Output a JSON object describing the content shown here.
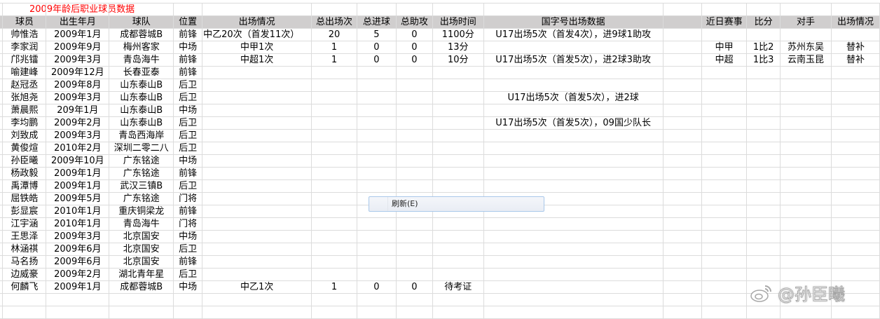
{
  "sheet_title": "2009年龄后职业球员数据",
  "headers": [
    "球员",
    "出生年月",
    "球队",
    "位置",
    "出场情况",
    "总出场次",
    "总进球",
    "总助攻",
    "出场时间",
    "国字号出场数据",
    "",
    "近日赛事",
    "比分",
    "对手",
    "出场情况"
  ],
  "players": [
    {
      "name": "帅惟浩",
      "birth": "2009年1月",
      "team": "成都蓉城B",
      "pos": "前锋",
      "apps": "中乙20次（首发11次）",
      "total": "20",
      "goals": "5",
      "assists": "0",
      "time": "1100分",
      "national": "U17出场5次（首发4次），进9球1助攻",
      "match": "",
      "score": "",
      "opponent": "",
      "status": ""
    },
    {
      "name": "李家润",
      "birth": "2009年9月",
      "team": "梅州客家",
      "pos": "中场",
      "apps": "中甲1次",
      "total": "1",
      "goals": "0",
      "assists": "0",
      "time": "13分",
      "national": "",
      "match": "中甲",
      "score": "1比2",
      "opponent": "苏州东吴",
      "status": "替补"
    },
    {
      "name": "邝兆镭",
      "birth": "2009年3月",
      "team": "青岛海牛",
      "pos": "前锋",
      "apps": "中超1次",
      "total": "1",
      "goals": "0",
      "assists": "0",
      "time": "10分",
      "national": "U17出场5次（首发5次），进2球3助攻",
      "match": "中超",
      "score": "1比3",
      "opponent": "云南玉昆",
      "status": "替补"
    },
    {
      "name": "喻建峰",
      "birth": "2009年12月",
      "team": "长春亚泰",
      "pos": "前锋",
      "apps": "",
      "total": "",
      "goals": "",
      "assists": "",
      "time": "",
      "national": "",
      "match": "",
      "score": "",
      "opponent": "",
      "status": ""
    },
    {
      "name": "赵冠丞",
      "birth": "2009年8月",
      "team": "山东泰山B",
      "pos": "后卫",
      "apps": "",
      "total": "",
      "goals": "",
      "assists": "",
      "time": "",
      "national": "",
      "match": "",
      "score": "",
      "opponent": "",
      "status": ""
    },
    {
      "name": "张旭尧",
      "birth": "2009年3月",
      "team": "山东泰山B",
      "pos": "后卫",
      "apps": "",
      "total": "",
      "goals": "",
      "assists": "",
      "time": "",
      "national": "U17出场5次（首发5次），进2球",
      "match": "",
      "score": "",
      "opponent": "",
      "status": ""
    },
    {
      "name": "萧晨熙",
      "birth": "209年1月",
      "team": "山东泰山B",
      "pos": "中场",
      "apps": "",
      "total": "",
      "goals": "",
      "assists": "",
      "time": "",
      "national": "",
      "match": "",
      "score": "",
      "opponent": "",
      "status": ""
    },
    {
      "name": "李均鹏",
      "birth": "2009年2月",
      "team": "山东泰山B",
      "pos": "后卫",
      "apps": "",
      "total": "",
      "goals": "",
      "assists": "",
      "time": "",
      "national": "U17出场5次（首发5次），09国少队长",
      "match": "",
      "score": "",
      "opponent": "",
      "status": ""
    },
    {
      "name": "刘致成",
      "birth": "2009年3月",
      "team": "青岛西海岸",
      "pos": "后卫",
      "apps": "",
      "total": "",
      "goals": "",
      "assists": "",
      "time": "",
      "national": "",
      "match": "",
      "score": "",
      "opponent": "",
      "status": ""
    },
    {
      "name": "黄俊煊",
      "birth": "2010年2月",
      "team": "深圳二零二八",
      "pos": "后卫",
      "apps": "",
      "total": "",
      "goals": "",
      "assists": "",
      "time": "",
      "national": "",
      "match": "",
      "score": "",
      "opponent": "",
      "status": ""
    },
    {
      "name": "孙臣曦",
      "birth": "2009年10月",
      "team": "广东铭途",
      "pos": "中场",
      "apps": "",
      "total": "",
      "goals": "",
      "assists": "",
      "time": "",
      "national": "",
      "match": "",
      "score": "",
      "opponent": "",
      "status": ""
    },
    {
      "name": "杨政毅",
      "birth": "2009年1月",
      "team": "广东铭途",
      "pos": "前锋",
      "apps": "",
      "total": "",
      "goals": "",
      "assists": "",
      "time": "",
      "national": "",
      "match": "",
      "score": "",
      "opponent": "",
      "status": ""
    },
    {
      "name": "禹潭博",
      "birth": "2009年1月",
      "team": "武汉三镇B",
      "pos": "后卫",
      "apps": "",
      "total": "",
      "goals": "",
      "assists": "",
      "time": "",
      "national": "",
      "match": "",
      "score": "",
      "opponent": "",
      "status": ""
    },
    {
      "name": "屈铁皓",
      "birth": "2009年5月",
      "team": "广东铭途",
      "pos": "门将",
      "apps": "",
      "total": "",
      "goals": "",
      "assists": "",
      "time": "",
      "national": "",
      "match": "",
      "score": "",
      "opponent": "",
      "status": ""
    },
    {
      "name": "彭显宸",
      "birth": "2010年1月",
      "team": "重庆铜梁龙",
      "pos": "前锋",
      "apps": "",
      "total": "",
      "goals": "",
      "assists": "",
      "time": "",
      "national": "",
      "match": "",
      "score": "",
      "opponent": "",
      "status": ""
    },
    {
      "name": "江宇涵",
      "birth": "2010年1月",
      "team": "青岛海牛",
      "pos": "门将",
      "apps": "",
      "total": "",
      "goals": "",
      "assists": "",
      "time": "",
      "national": "",
      "match": "",
      "score": "",
      "opponent": "",
      "status": ""
    },
    {
      "name": "王思泽",
      "birth": "2009年3月",
      "team": "北京国安",
      "pos": "中场",
      "apps": "",
      "total": "",
      "goals": "",
      "assists": "",
      "time": "",
      "national": "",
      "match": "",
      "score": "",
      "opponent": "",
      "status": ""
    },
    {
      "name": "林涵祺",
      "birth": "2009年6月",
      "team": "北京国安",
      "pos": "后卫",
      "apps": "",
      "total": "",
      "goals": "",
      "assists": "",
      "time": "",
      "national": "",
      "match": "",
      "score": "",
      "opponent": "",
      "status": ""
    },
    {
      "name": "马名扬",
      "birth": "2009年6月",
      "team": "北京国安",
      "pos": "前锋",
      "apps": "",
      "total": "",
      "goals": "",
      "assists": "",
      "time": "",
      "national": "",
      "match": "",
      "score": "",
      "opponent": "",
      "status": ""
    },
    {
      "name": "边威豪",
      "birth": "2009年2月",
      "team": "湖北青年星",
      "pos": "后卫",
      "apps": "",
      "total": "",
      "goals": "",
      "assists": "",
      "time": "",
      "national": "",
      "match": "",
      "score": "",
      "opponent": "",
      "status": ""
    },
    {
      "name": "何麟飞",
      "birth": "2009年1月",
      "team": "成都蓉城B",
      "pos": "中场",
      "apps": "中乙1次",
      "total": "1",
      "goals": "0",
      "assists": "0",
      "time": "待考证",
      "national": "",
      "match": "",
      "score": "",
      "opponent": "",
      "status": ""
    }
  ],
  "context_menu": {
    "refresh_label": "刷新(E)"
  },
  "watermark": "@孙臣曦"
}
